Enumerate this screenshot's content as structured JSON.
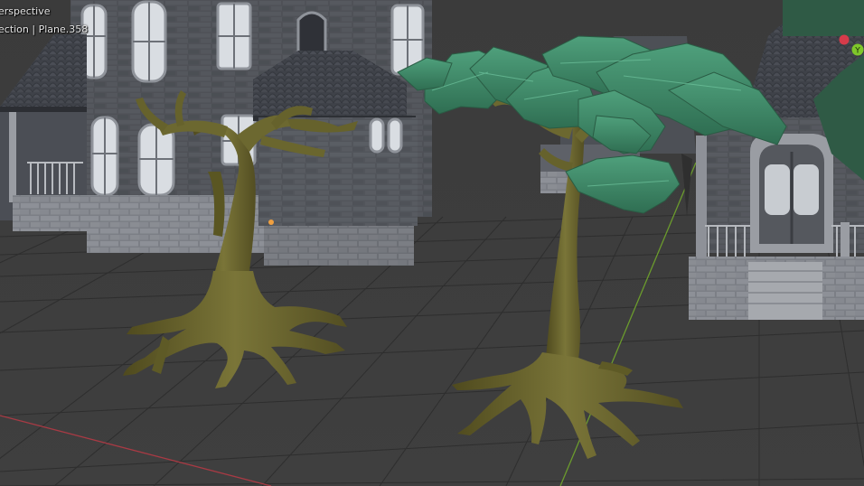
{
  "viewport": {
    "view_mode": "erspective",
    "collection_line": "ection | Plane.358"
  },
  "gizmo": {
    "x_color": "#d63b4a",
    "y_color": "#7fc72a",
    "y_label": "Y"
  },
  "colors": {
    "background": "#3a3a3a",
    "grid_line": "#2f2f2f",
    "x_axis": "#a83a44",
    "y_axis": "#6b9b2d",
    "stone": "#5b5e66",
    "roof": "#4a4d55",
    "window_light": "#d9dde2",
    "bark": "#6e6a32",
    "leaves": "#3d8a68"
  }
}
